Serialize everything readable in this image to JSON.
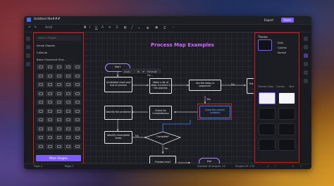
{
  "window": {
    "title": "Untitled file###"
  },
  "header": {
    "export_label": "Export",
    "share_label": "Share"
  },
  "toolbar": {
    "font": "Arial"
  },
  "sidebar": {
    "search_placeholder": "Search Shapes",
    "sections": [
      "Arrow Shapes",
      "Callouts",
      "Basic Flowchart Sha..."
    ],
    "more_shapes_label": "More Shapes"
  },
  "canvas": {
    "title": "Process Map Examples",
    "nodes": {
      "start": "Start",
      "n1": "Undertake chart and end of process",
      "n2": "Make a list of steps involved in the process",
      "n3": "Are the steps in sequence?",
      "n4": "Put steps in correct sequence",
      "n5": "Identify the problems",
      "n6": "Check for Completeness",
      "n7": "Draw the correct symbols",
      "n8": "Identify incomplete areas",
      "n9": "Complete?",
      "n10": "Finalize chart",
      "end": "End"
    },
    "labels": {
      "no1": "No",
      "yes1": "Yes",
      "no2": "No",
      "yes2": "Yes"
    },
    "context_menu": {
      "font": "Arial",
      "format_label": "Format Pai..."
    }
  },
  "right_panel": {
    "title": "Theme",
    "options": [
      "Dark",
      "Colorful",
      "Normal"
    ],
    "tabs": [
      "Theme",
      "Color",
      "Conne...",
      "Text"
    ]
  },
  "status": {
    "page": "Page-1",
    "page_tab": "Page-1",
    "shapes": "Number of shapes: 19",
    "zoom": "Shapes ID: 170"
  },
  "colors": {
    "accent": "#7c5cff",
    "selection_red": "#d32020",
    "title_purple": "#d06bff",
    "link_blue": "#3e7bff"
  }
}
